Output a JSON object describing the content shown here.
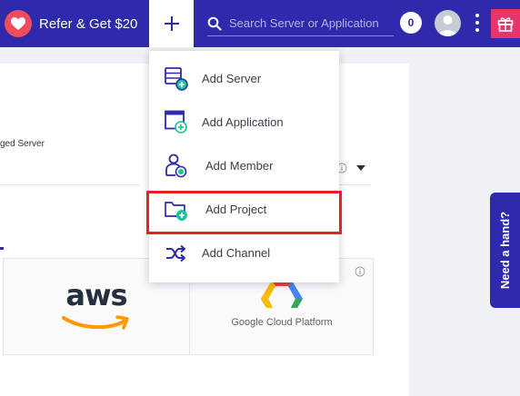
{
  "topbar": {
    "refer_label": "Refer & Get $20",
    "search_placeholder": "Search Server or Application",
    "notification_count": "0"
  },
  "background": {
    "managed_server_fragment": "ged Server"
  },
  "providers": {
    "aws_label": "aws",
    "gcp_label": "Google Cloud Platform"
  },
  "help_tab": {
    "label": "Need a hand?"
  },
  "add_menu": {
    "items": [
      {
        "label": "Add Server",
        "icon": "server-add-icon"
      },
      {
        "label": "Add Application",
        "icon": "application-add-icon"
      },
      {
        "label": "Add Member",
        "icon": "member-add-icon"
      },
      {
        "label": "Add Project",
        "icon": "folder-add-icon"
      },
      {
        "label": "Add Channel",
        "icon": "shuffle-icon"
      }
    ],
    "highlighted_item": "Add Project"
  },
  "colors": {
    "brand": "#2e2aab",
    "accent_green": "#19c59a",
    "heart": "#ef4c5c",
    "gift": "#e8336b",
    "highlight": "#e5202a"
  }
}
